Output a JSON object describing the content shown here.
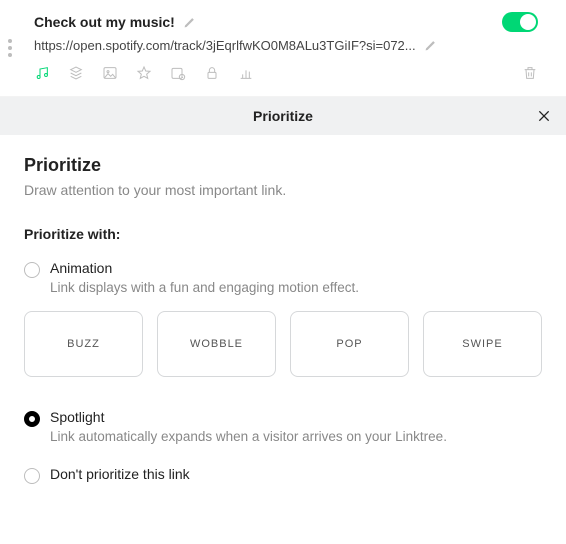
{
  "link": {
    "title": "Check out my music!",
    "url": "https://open.spotify.com/track/3jEqrlfwKO0M8ALu3TGiIF?si=072..."
  },
  "bar": {
    "title": "Prioritize"
  },
  "panel": {
    "heading": "Prioritize",
    "sub": "Draw attention to your most important link.",
    "section_label": "Prioritize with:",
    "animation": {
      "title": "Animation",
      "desc": "Link displays with a fun and engaging motion effect.",
      "options": [
        "BUZZ",
        "WOBBLE",
        "POP",
        "SWIPE"
      ]
    },
    "spotlight": {
      "title": "Spotlight",
      "desc": "Link automatically expands when a visitor arrives on your Linktree."
    },
    "none": {
      "title": "Don't prioritize this link"
    }
  }
}
